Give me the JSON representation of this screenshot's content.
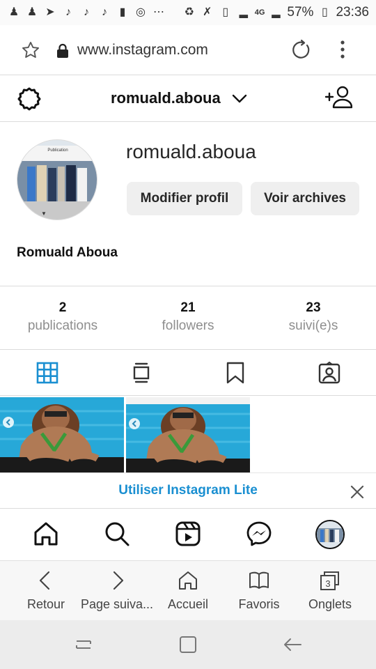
{
  "status_bar": {
    "battery": "57%",
    "time": "23:36",
    "network": "4G",
    "icons": [
      "person-add-icon",
      "person-add-icon",
      "telegram-icon",
      "tiktok-icon",
      "tiktok-icon",
      "tiktok-icon",
      "message-icon",
      "chrome-icon",
      "more-dots-icon",
      "recycle-icon",
      "mute-icon",
      "sim-icon",
      "signal-icon",
      "signal-icon"
    ]
  },
  "browser": {
    "url": "www.instagram.com",
    "bottom_bar": [
      {
        "icon": "back-chevron-icon",
        "label": "Retour"
      },
      {
        "icon": "forward-chevron-icon",
        "label": "Page suiva..."
      },
      {
        "icon": "home-outline-icon",
        "label": "Accueil"
      },
      {
        "icon": "book-icon",
        "label": "Favoris"
      },
      {
        "icon": "tabs-icon",
        "label": "Onglets",
        "count": "3"
      }
    ]
  },
  "header": {
    "username": "romuald.aboua"
  },
  "profile": {
    "username": "romuald.aboua",
    "full_name": "Romuald Aboua",
    "edit_button": "Modifier profil",
    "archive_button": "Voir archives",
    "avatar_caption": "Publication"
  },
  "stats": [
    {
      "value": "2",
      "label": "publications"
    },
    {
      "value": "21",
      "label": "followers"
    },
    {
      "value": "23",
      "label": "suivi(e)s"
    }
  ],
  "tabs": [
    "grid-icon",
    "feed-icon",
    "bookmark-icon",
    "tagged-icon"
  ],
  "banner": {
    "text": "Utiliser Instagram Lite"
  },
  "nav": [
    "home-icon",
    "search-icon",
    "reels-icon",
    "messenger-icon",
    "profile-avatar"
  ],
  "colors": {
    "accent_blue": "#1a8fd1",
    "tab_active": "#1a8fd1",
    "border": "#dbdbdb"
  }
}
